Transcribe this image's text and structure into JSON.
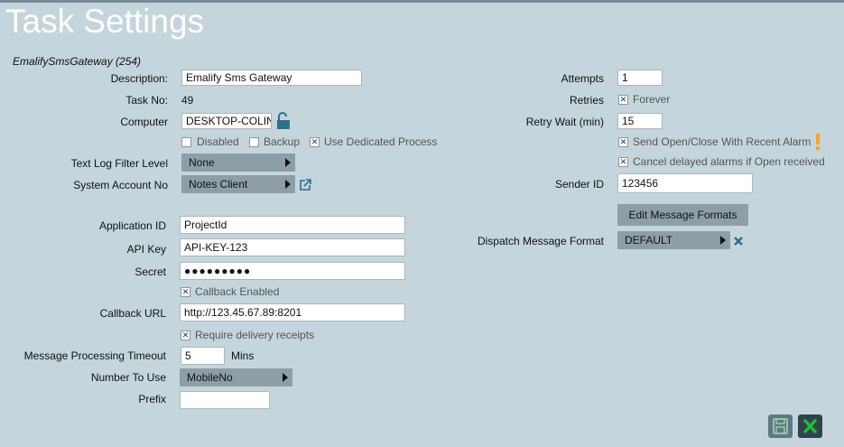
{
  "page": {
    "title": "Task Settings",
    "subtitle": "EmalifySmsGateway (254)"
  },
  "left": {
    "description": {
      "label": "Description:",
      "value": "Emalify Sms Gateway"
    },
    "task_no": {
      "label": "Task No:",
      "value": "49"
    },
    "computer": {
      "label": "Computer",
      "value": "DESKTOP-COLIN"
    },
    "checks": {
      "disabled": "Disabled",
      "backup": "Backup",
      "dedicated": "Use Dedicated Process"
    },
    "log_filter": {
      "label": "Text Log Filter Level",
      "value": "None"
    },
    "system_account": {
      "label": "System Account No",
      "value": "Notes Client"
    },
    "application_id": {
      "label": "Application ID",
      "value": "ProjectId"
    },
    "api_key": {
      "label": "API Key",
      "value": "API-KEY-123"
    },
    "secret": {
      "label": "Secret",
      "value": "●●●●●●●●●"
    },
    "callback_enabled": "Callback Enabled",
    "callback_url": {
      "label": "Callback URL",
      "value": "http://123.45.67.89:8201"
    },
    "require_receipts": "Require delivery receipts",
    "timeout": {
      "label": "Message Processing Timeout",
      "value": "5",
      "unit": "Mins"
    },
    "number_to_use": {
      "label": "Number To Use",
      "value": "MobileNo"
    },
    "prefix": {
      "label": "Prefix",
      "value": ""
    }
  },
  "right": {
    "attempts": {
      "label": "Attempts",
      "value": "1"
    },
    "retries": {
      "label": "Retries",
      "check_label": "Forever"
    },
    "retry_wait": {
      "label": "Retry Wait (min)",
      "value": "15"
    },
    "send_open_close": "Send Open/Close With Recent Alarm",
    "cancel_delayed": "Cancel delayed alarms if Open received",
    "sender_id": {
      "label": "Sender ID",
      "value": "123456"
    },
    "edit_formats": "Edit Message Formats",
    "dispatch_format": {
      "label": "Dispatch Message Format",
      "value": "DEFAULT"
    }
  },
  "checkbox_states": {
    "disabled": false,
    "backup": false,
    "dedicated": true,
    "callback_enabled": true,
    "require_receipts": true,
    "forever": true,
    "send_open_close": true,
    "cancel_delayed": true
  },
  "colors": {
    "background": "#c4d5dc",
    "combo": "#8e9ea6",
    "warning": "#f5a623",
    "save_icon": "#5c7a86",
    "close_icon": "#22bb33"
  },
  "icons": [
    "unlock-icon",
    "external-link-icon",
    "warning-icon",
    "clear-x-icon",
    "save-icon",
    "close-icon"
  ]
}
